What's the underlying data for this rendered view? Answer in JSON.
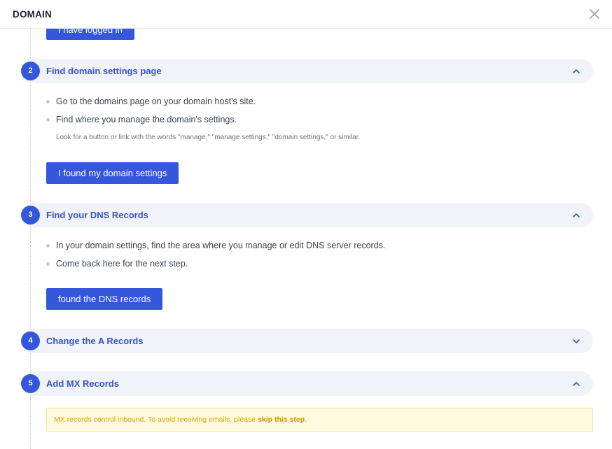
{
  "header": {
    "title": "DOMAIN",
    "close_icon": "close-icon"
  },
  "step1": {
    "button_label": "I have logged in"
  },
  "steps": [
    {
      "number": "2",
      "title": "Find domain settings page",
      "expanded": true,
      "bullets": [
        "Go to the domains page on your domain host's site.",
        "Find where you manage the domain's settings."
      ],
      "hint": "Look for a button or link with the words \"manage,\" \"manage settings,\" \"domain settings,\" or similar.",
      "button_label": "I found my domain settings"
    },
    {
      "number": "3",
      "title": "Find your DNS Records",
      "expanded": true,
      "bullets": [
        "In your domain settings, find the area where you manage or edit DNS server records.",
        "Come back here for the next step."
      ],
      "button_label": "found the DNS records"
    },
    {
      "number": "4",
      "title": "Change the A Records",
      "expanded": false
    },
    {
      "number": "5",
      "title": "Add MX Records",
      "expanded": true,
      "warning": {
        "text": "MX records control inbound. To avoid receiving emails, please ",
        "link": "skip this step",
        "suffix": "."
      }
    }
  ],
  "colors": {
    "primary": "#3457db",
    "header_bg": "#f1f3fb",
    "title": "#3652c8",
    "warning_bg": "#fff9e0",
    "warning_text": "#d9a300"
  }
}
